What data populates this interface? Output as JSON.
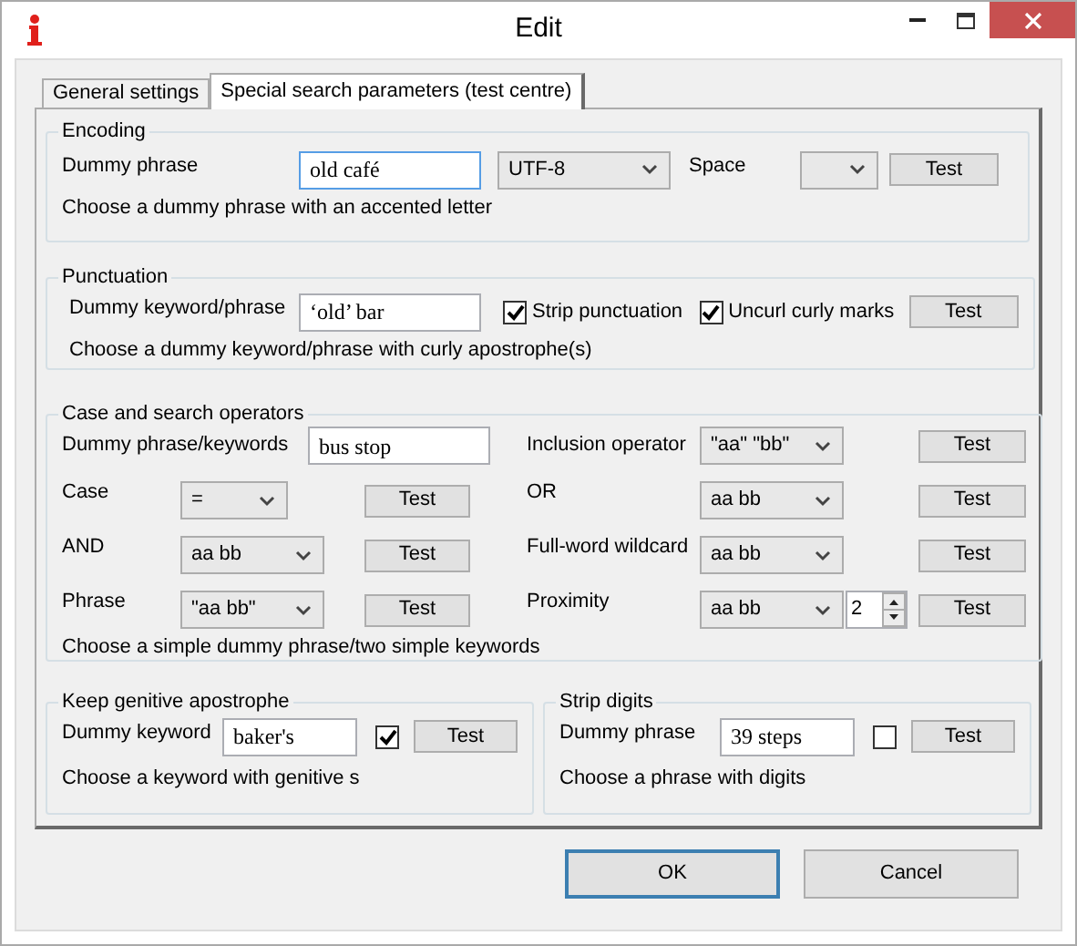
{
  "window": {
    "title": "Edit"
  },
  "tabs": [
    {
      "label": "General settings",
      "selected": false
    },
    {
      "label": "Special search parameters (test centre)",
      "selected": true
    }
  ],
  "encoding": {
    "legend": "Encoding",
    "label": "Dummy phrase",
    "value": "old café",
    "focused": true,
    "encoding_select": "UTF-8",
    "space_label": "Space",
    "button": "Test",
    "hint": "Choose a dummy phrase with an accented letter"
  },
  "punctuation": {
    "legend": "Punctuation",
    "label": "Dummy keyword/phrase",
    "value": "‘old’ bar",
    "checkboxes": [
      {
        "label": "Strip punctuation",
        "checked": true
      },
      {
        "label": "Uncurl curly marks",
        "checked": true
      }
    ],
    "button": "Test",
    "hint": "Choose a dummy keyword/phrase with curly apostrophe(s)"
  },
  "case_and_operators": {
    "legend": "Case and search operators",
    "keywords_label": "Dummy phrase/keywords",
    "keywords_value": "bus stop",
    "left_rows": [
      {
        "label": "Case",
        "value": "=",
        "button": "Test"
      },
      {
        "label": "AND",
        "value": "aa bb",
        "button": "Test"
      },
      {
        "label": "Phrase",
        "value": "\"aa bb\"",
        "button": "Test"
      }
    ],
    "right_rows": [
      {
        "label": "Inclusion operator",
        "value": "\"aa\" \"bb\"",
        "button": "Test"
      },
      {
        "label": "OR",
        "value": "aa bb",
        "button": "Test"
      },
      {
        "label": "Full-word wildcard",
        "value": "aa bb",
        "button": "Test"
      },
      {
        "label": "Proximity",
        "value": "aa bb",
        "spin_value": "2",
        "button": "Test"
      }
    ],
    "hint": "Choose a simple dummy phrase/two simple keywords"
  },
  "bottom_groups": [
    {
      "legend": "Keep genitive apostrophe",
      "label": "Dummy keyword",
      "value": "baker's",
      "checked": true,
      "button": "Test",
      "hint": "Choose a keyword with genitive s"
    },
    {
      "legend": "Strip digits",
      "label": "Dummy phrase",
      "value": "39 steps",
      "checked": false,
      "button": "Test",
      "hint": "Choose a phrase with digits"
    }
  ],
  "buttons": [
    {
      "label": "OK",
      "default": true
    },
    {
      "label": "Cancel",
      "default": false
    }
  ]
}
